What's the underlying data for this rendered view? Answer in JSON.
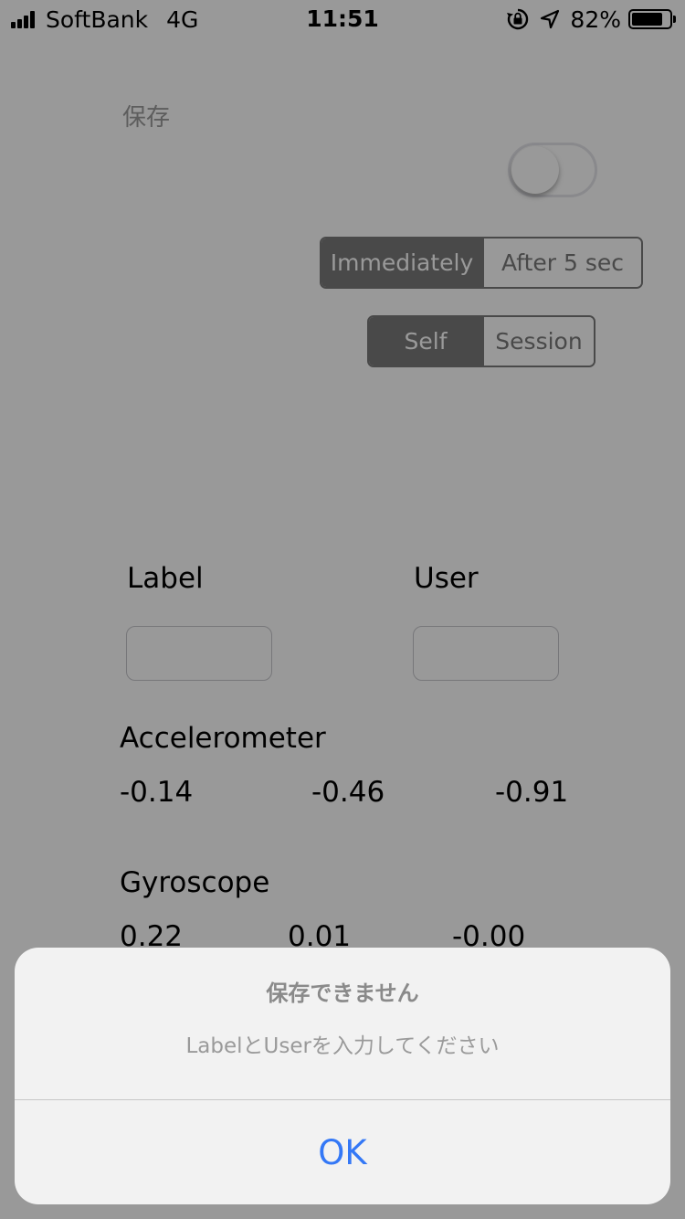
{
  "status_bar": {
    "carrier": "SoftBank",
    "network": "4G",
    "time": "11:51",
    "battery_percent": "82%",
    "battery_level": 0.82,
    "icons": [
      "signal-icon",
      "orientation-lock-icon",
      "location-icon",
      "battery-icon"
    ]
  },
  "form": {
    "save_label": "保存",
    "save_switch_on": false,
    "timing_segment": {
      "options": [
        "Immediately",
        "After 5 sec"
      ],
      "selected": 0
    },
    "mode_segment": {
      "options": [
        "Self",
        "Session"
      ],
      "selected": 0
    },
    "label_title": "Label",
    "label_value": "",
    "user_title": "User",
    "user_value": ""
  },
  "sensors": {
    "accelerometer": {
      "title": "Accelerometer",
      "x": "-0.14",
      "y": "-0.46",
      "z": "-0.91"
    },
    "gyroscope": {
      "title": "Gyroscope",
      "x": "0.22",
      "y": "0.01",
      "z": "-0.00"
    }
  },
  "alert": {
    "title": "保存できません",
    "message": "LabelとUserを入力してください",
    "ok_label": "OK"
  },
  "colors": {
    "dim_overlay": "rgba(0,0,0,0.4)",
    "alert_background": "#f2f2f2",
    "accent": "#3478f6",
    "segment_tint": "#7a7a7a"
  }
}
